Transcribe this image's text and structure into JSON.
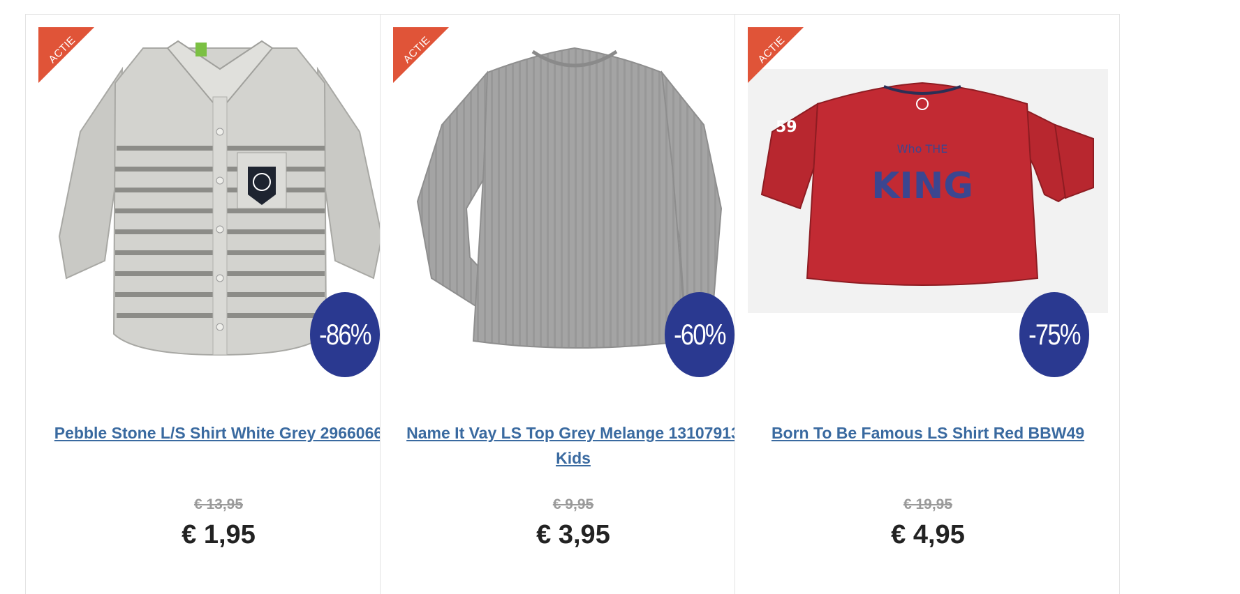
{
  "colors": {
    "ribbon": "#e05438",
    "badge": "#2a3990",
    "title_link": "#3a6aa0",
    "price": "#222222",
    "old_price": "#9a9a9a"
  },
  "products": [
    {
      "ribbon": "ACTIE",
      "discount": "-86%",
      "title": "Pebble Stone L/S Shirt White Grey 2966066",
      "old_price": "€ 13,95",
      "price": "€ 1,95",
      "image": "grey-striped-button-shirt"
    },
    {
      "ribbon": "ACTIE",
      "discount": "-60%",
      "title": "Name It Vay LS Top Grey Melange 13107913 Kids",
      "old_price": "€ 9,95",
      "price": "€ 3,95",
      "image": "grey-ribbed-long-sleeve-top"
    },
    {
      "ribbon": "ACTIE",
      "discount": "-75%",
      "title": "Born To Be Famous LS Shirt Red BBW49",
      "old_price": "€ 19,95",
      "price": "€ 4,95",
      "image": "red-king-long-sleeve-shirt"
    }
  ]
}
